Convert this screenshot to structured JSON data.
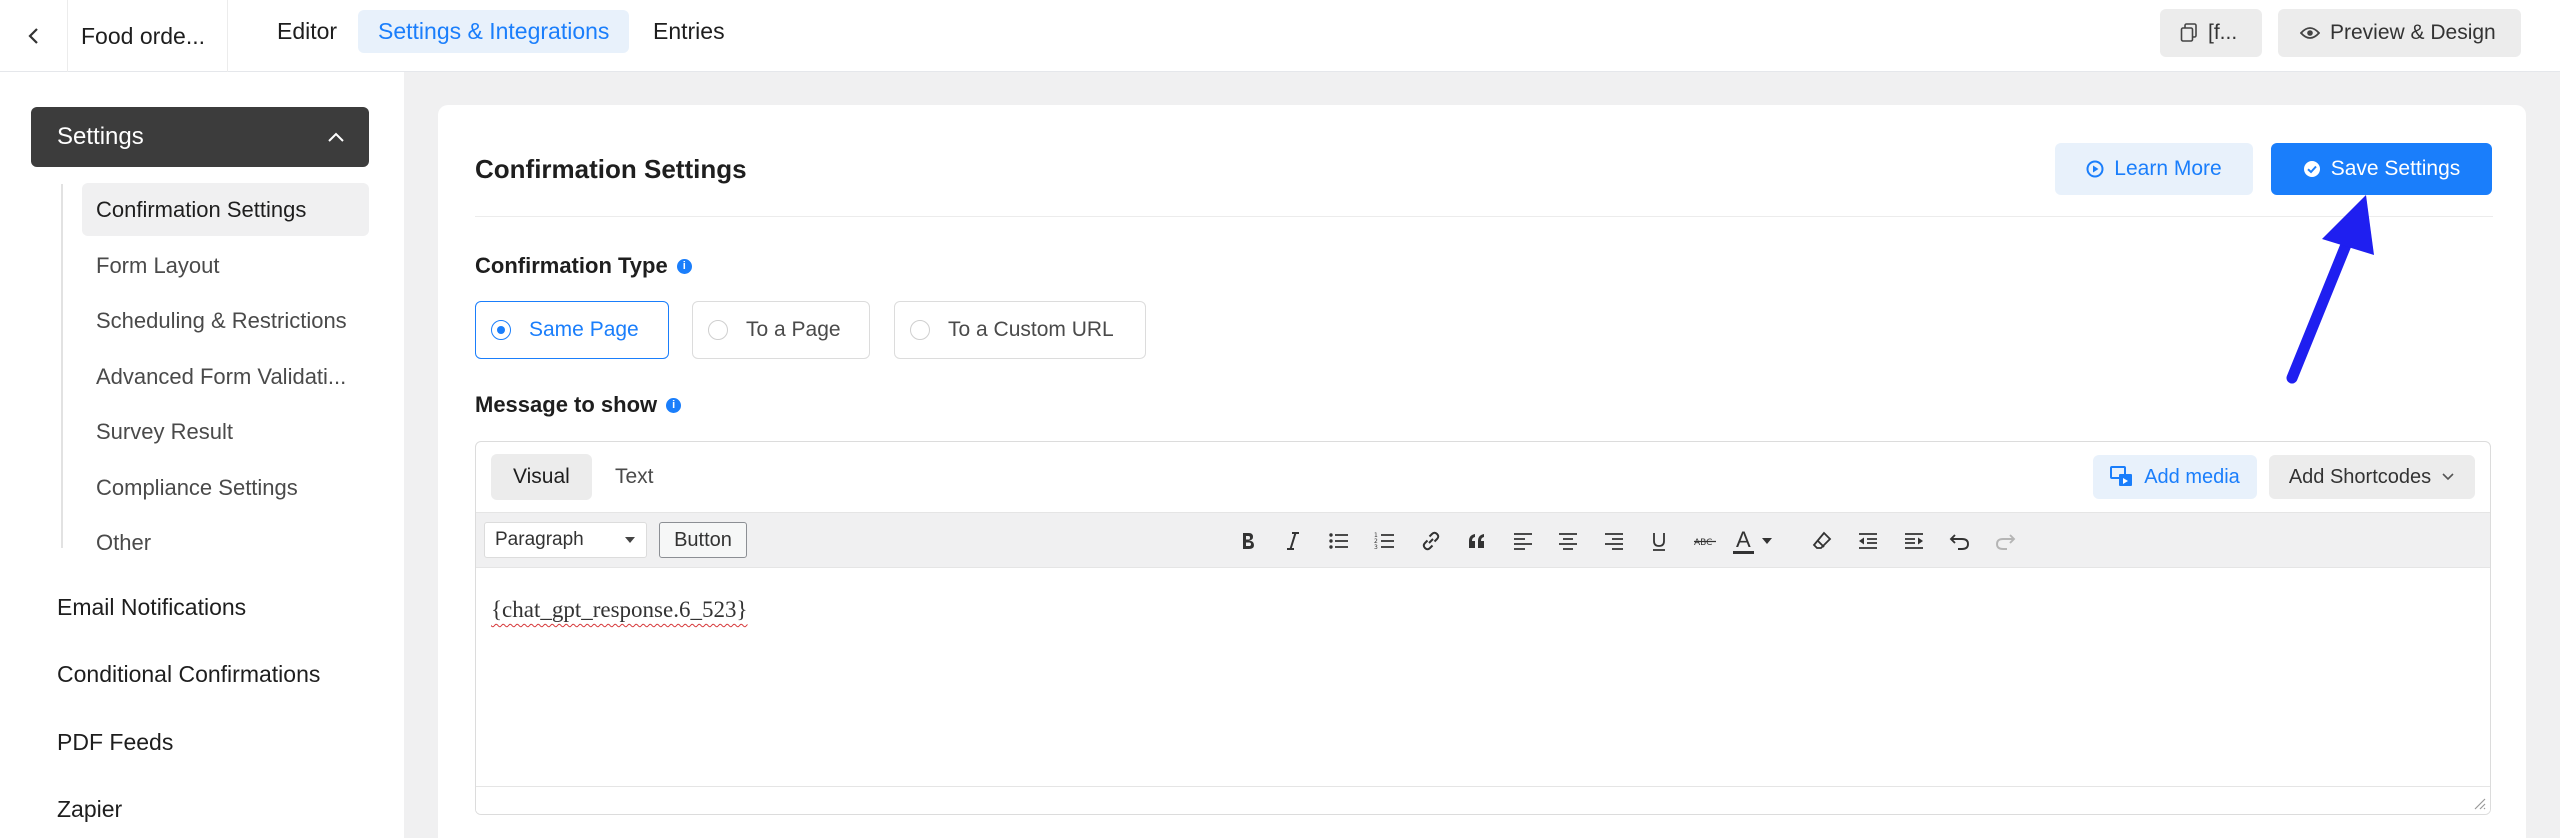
{
  "topbar": {
    "form_name": "Food orde...",
    "tabs": [
      {
        "label": "Editor",
        "active": false
      },
      {
        "label": "Settings & Integrations",
        "active": true
      },
      {
        "label": "Entries",
        "active": false
      }
    ],
    "shortcode_button": "[f...",
    "preview_button": "Preview & Design"
  },
  "sidebar": {
    "section_title": "Settings",
    "sub_items": [
      {
        "label": "Confirmation Settings",
        "active": true
      },
      {
        "label": "Form Layout",
        "active": false
      },
      {
        "label": "Scheduling & Restrictions",
        "active": false
      },
      {
        "label": "Advanced Form Validati...",
        "active": false
      },
      {
        "label": "Survey Result",
        "active": false
      },
      {
        "label": "Compliance Settings",
        "active": false
      },
      {
        "label": "Other",
        "active": false
      }
    ],
    "main_items": [
      {
        "label": "Email Notifications"
      },
      {
        "label": "Conditional Confirmations"
      },
      {
        "label": "PDF Feeds"
      },
      {
        "label": "Zapier"
      }
    ]
  },
  "main": {
    "title": "Confirmation Settings",
    "learn_more": "Learn More",
    "save_settings": "Save Settings",
    "confirmation_type_label": "Confirmation Type",
    "confirmation_options": [
      {
        "label": "Same Page",
        "checked": true
      },
      {
        "label": "To a Page",
        "checked": false
      },
      {
        "label": "To a Custom URL",
        "checked": false
      }
    ],
    "message_label": "Message to show",
    "editor": {
      "tabs": [
        {
          "label": "Visual",
          "active": true
        },
        {
          "label": "Text",
          "active": false
        }
      ],
      "add_media": "Add media",
      "add_shortcodes": "Add Shortcodes",
      "format_select": "Paragraph",
      "button_label": "Button",
      "text_color_letter": "A",
      "content": "{chat_gpt_response.6_523}"
    }
  },
  "colors": {
    "accent": "#1a7efb",
    "sidebar_active_bg": "#3c3c3c",
    "annotation_arrow": "#1f1ff0"
  }
}
